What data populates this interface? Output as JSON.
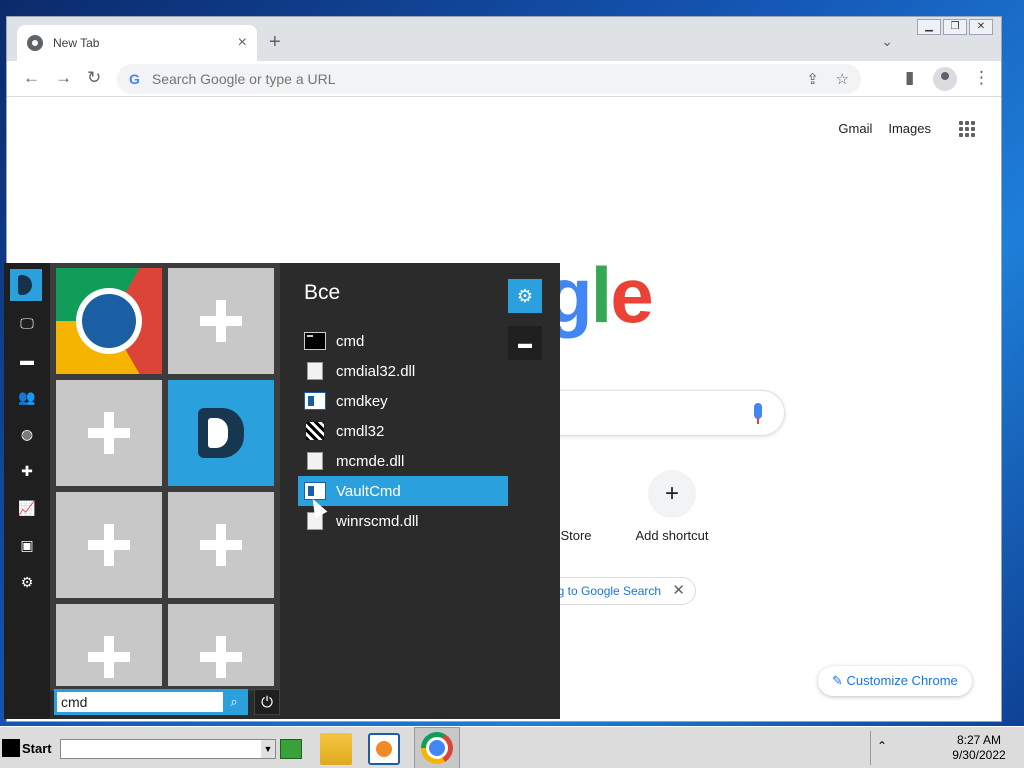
{
  "browser": {
    "tab_title": "New Tab",
    "omnibox_placeholder": "Search Google or type a URL",
    "links": {
      "gmail": "Gmail",
      "images": "Images"
    },
    "logo_fragment": "gle",
    "shortcuts": {
      "store_label": "Store",
      "add_label": "Add shortcut"
    },
    "chip_text": "ng to Google Search",
    "customize_label": "Customize Chrome"
  },
  "startmenu": {
    "results_title": "Все",
    "results": [
      {
        "name": "cmd",
        "icon": "console-icon"
      },
      {
        "name": "cmdial32.dll",
        "icon": "dll-file-icon"
      },
      {
        "name": "cmdkey",
        "icon": "key-window-icon"
      },
      {
        "name": "cmdl32",
        "icon": "exe-icon"
      },
      {
        "name": "mcmde.dll",
        "icon": "dll-file-icon"
      },
      {
        "name": "VaultCmd",
        "icon": "key-window-icon",
        "selected": true
      },
      {
        "name": "winrscmd.dll",
        "icon": "dll-file-icon"
      }
    ],
    "search_value": "cmd"
  },
  "taskbar": {
    "start_label": "Start",
    "clock_time": "8:27 AM",
    "clock_date": "9/30/2022"
  },
  "colors": {
    "accent": "#2aa1dd",
    "menu_bg": "#2b2b2b",
    "link_blue": "#1a73e8"
  }
}
